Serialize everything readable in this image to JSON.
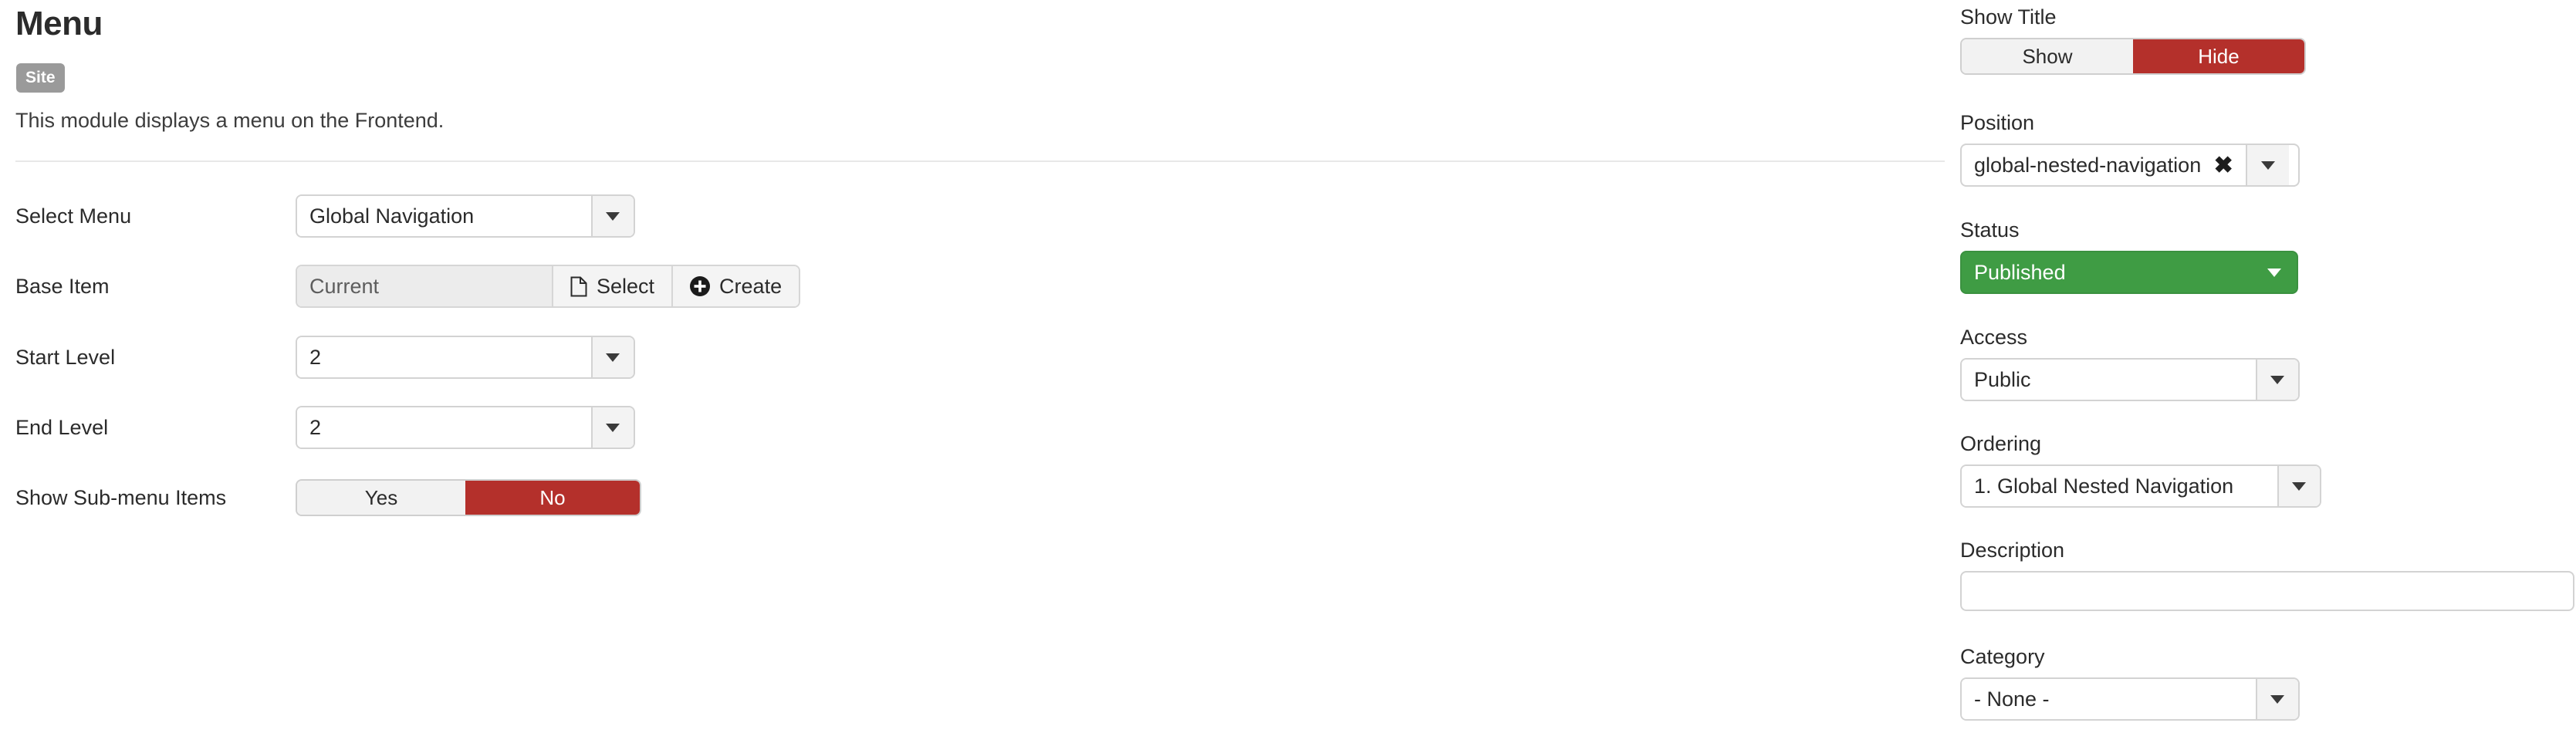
{
  "header": {
    "title": "Menu",
    "badge": "Site",
    "description": "This module displays a menu on the Frontend."
  },
  "colors": {
    "badge_gray": "#9a9a9a",
    "toggle_red": "#b4302b",
    "status_green": "#3f9c44",
    "border_gray": "#d3d3d3",
    "field_disabled_bg": "#ececec"
  },
  "form": {
    "select_menu": {
      "label": "Select Menu",
      "value": "Global Navigation",
      "icon": "chevron-down-icon"
    },
    "base_item": {
      "label": "Base Item",
      "value": "Current",
      "select_button": "Select",
      "select_icon": "document-icon",
      "create_button": "Create",
      "create_icon": "plus-circle-icon"
    },
    "start_level": {
      "label": "Start Level",
      "value": "2",
      "icon": "chevron-down-icon"
    },
    "end_level": {
      "label": "End Level",
      "value": "2",
      "icon": "chevron-down-icon"
    },
    "show_submenu": {
      "label": "Show Sub-menu Items",
      "option_yes": "Yes",
      "option_no": "No",
      "selected": "No"
    }
  },
  "sidebar": {
    "show_title": {
      "label": "Show Title",
      "option_show": "Show",
      "option_hide": "Hide",
      "selected": "Hide"
    },
    "position": {
      "label": "Position",
      "value": "global-nested-navigation",
      "clear_icon": "close-icon",
      "dropdown_icon": "chevron-down-icon"
    },
    "status": {
      "label": "Status",
      "value": "Published",
      "icon": "chevron-down-icon"
    },
    "access": {
      "label": "Access",
      "value": "Public",
      "icon": "chevron-down-icon"
    },
    "ordering": {
      "label": "Ordering",
      "value": "1. Global Nested Navigation",
      "icon": "chevron-down-icon"
    },
    "description": {
      "label": "Description",
      "value": "",
      "placeholder": ""
    },
    "category": {
      "label": "Category",
      "value": "- None -",
      "icon": "chevron-down-icon"
    }
  }
}
